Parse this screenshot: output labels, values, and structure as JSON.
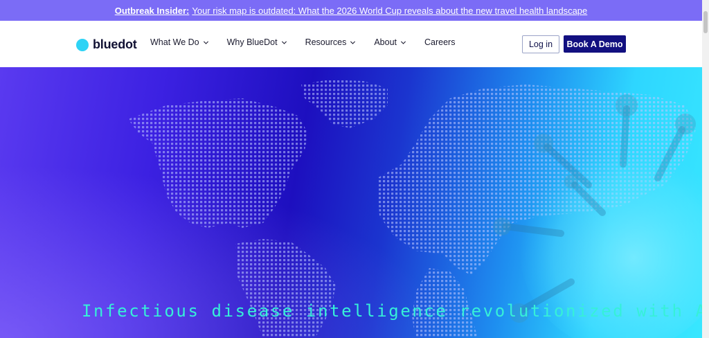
{
  "banner": {
    "strong": "Outbreak Insider:",
    "text": "Your risk map is outdated: What the 2026 World Cup reveals about the new travel health landscape"
  },
  "header": {
    "logo_text": "bluedot",
    "nav": [
      {
        "label": "What We Do",
        "has_dropdown": true
      },
      {
        "label": "Why BlueDot",
        "has_dropdown": true
      },
      {
        "label": "Resources",
        "has_dropdown": true
      },
      {
        "label": "About",
        "has_dropdown": true
      },
      {
        "label": "Careers",
        "has_dropdown": false
      }
    ],
    "login_label": "Log in",
    "demo_label": "Book A Demo"
  },
  "hero": {
    "headline": "Infectious disease intelligence revolutionized with AI"
  },
  "colors": {
    "banner": "#7b6cf6",
    "brand_dot": "#2ed3f5",
    "demo_button": "#121080",
    "headline": "#36f0d8"
  }
}
